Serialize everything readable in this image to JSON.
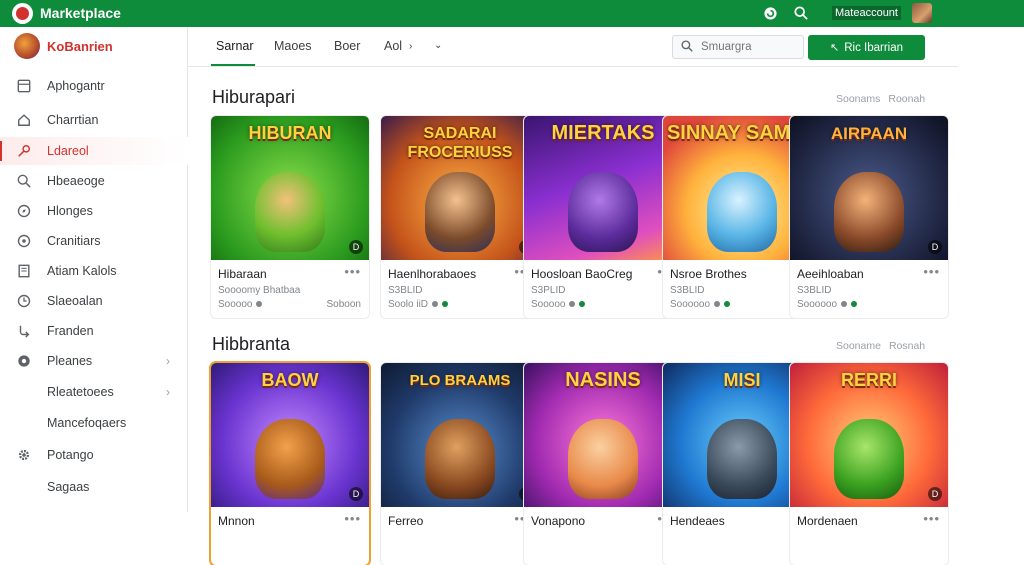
{
  "topbar": {
    "title": "Marketplace",
    "account": "Mateaccount",
    "icons": [
      "logo-icon",
      "refresh-icon",
      "search-icon",
      "avatar"
    ]
  },
  "sidebar": {
    "profile_name": "KoBanrien",
    "items": [
      {
        "label": "Aphogantr",
        "icon": "apps-icon",
        "active": false,
        "chevron": false
      },
      {
        "label": "Charrtian",
        "icon": "home-icon",
        "active": false,
        "chevron": false
      },
      {
        "label": "Ldareol",
        "icon": "key-icon",
        "active": true,
        "chevron": false
      },
      {
        "label": "Hbeaeoge",
        "icon": "search-icon",
        "active": false,
        "chevron": false
      },
      {
        "label": "Hlonges",
        "icon": "compass-icon",
        "active": false,
        "chevron": false
      },
      {
        "label": "Cranitiars",
        "icon": "globe-icon",
        "active": false,
        "chevron": false
      },
      {
        "label": "Atiam Kalols",
        "icon": "document-icon",
        "active": false,
        "chevron": false
      },
      {
        "label": "Slaeoalan",
        "icon": "clock-icon",
        "active": false,
        "chevron": false
      },
      {
        "label": "Franden",
        "icon": "branch-icon",
        "active": false,
        "chevron": false
      },
      {
        "label": "Pleanes",
        "icon": "circle-icon",
        "active": false,
        "chevron": true
      },
      {
        "label": "Rleatetoees",
        "icon": "",
        "active": false,
        "chevron": true
      },
      {
        "label": "Mancefoqaers",
        "icon": "",
        "active": false,
        "chevron": false
      },
      {
        "label": "Potango",
        "icon": "gear-icon",
        "active": false,
        "chevron": false
      },
      {
        "label": "Sagaas",
        "icon": "",
        "active": false,
        "chevron": false
      }
    ]
  },
  "tabs": [
    {
      "label": "Sarnar",
      "active": true
    },
    {
      "label": "Maoes",
      "active": false
    },
    {
      "label": "Boer",
      "active": false
    },
    {
      "label": "Aol",
      "active": false
    }
  ],
  "search": {
    "placeholder": "Smuargra"
  },
  "primary_button": {
    "label": "Ric Ibarrian"
  },
  "sections": [
    {
      "title": "Hiburapari",
      "links": [
        "Soonams",
        "Roonah"
      ],
      "cards": [
        {
          "art_title": "HIBURAN",
          "name": "Hibaraan",
          "meta1": "Soooomy Bhatbaa",
          "meta2": "Sooooo",
          "meta2_right": "Soboon",
          "theme": "green"
        },
        {
          "art_title": "SADARAI FROCERIUSS",
          "name": "Haenlhorabaoes",
          "meta1": "S3BLID",
          "meta2": "Soolo iiD",
          "meta2_right": "",
          "theme": "orange"
        },
        {
          "art_title": "MIERTAKS",
          "name": "Hoosloan BaoCreg",
          "meta1": "S3PLID",
          "meta2": "Sooooo",
          "meta2_right": "",
          "theme": "purple"
        },
        {
          "art_title": "SINNAY SAMEE",
          "name": "Nsroe Brothes",
          "meta1": "S3BLID",
          "meta2": "Soooooo",
          "meta2_right": "",
          "theme": "yellow"
        },
        {
          "art_title": "AIRPAAN",
          "name": "Aeeihloaban",
          "meta1": "S3BLID",
          "meta2": "Soooooo",
          "meta2_right": "",
          "theme": "dark"
        }
      ]
    },
    {
      "title": "Hibbranta",
      "links": [
        "Sooname",
        "Rosnah"
      ],
      "cards": [
        {
          "art_title": "BAOW",
          "name": "Mnnon",
          "theme": "purple2"
        },
        {
          "art_title": "PLO BRAAMS",
          "name": "Ferreo",
          "theme": "orange2"
        },
        {
          "art_title": "NASINS",
          "name": "Vonapono",
          "theme": "pink"
        },
        {
          "art_title": "MISI",
          "name": "Hendeaes",
          "theme": "blue"
        },
        {
          "art_title": "RERRI",
          "name": "Mordenaen",
          "theme": "red"
        }
      ]
    }
  ],
  "colors": {
    "accent": "#0f8b3c",
    "active": "#d2322d"
  }
}
